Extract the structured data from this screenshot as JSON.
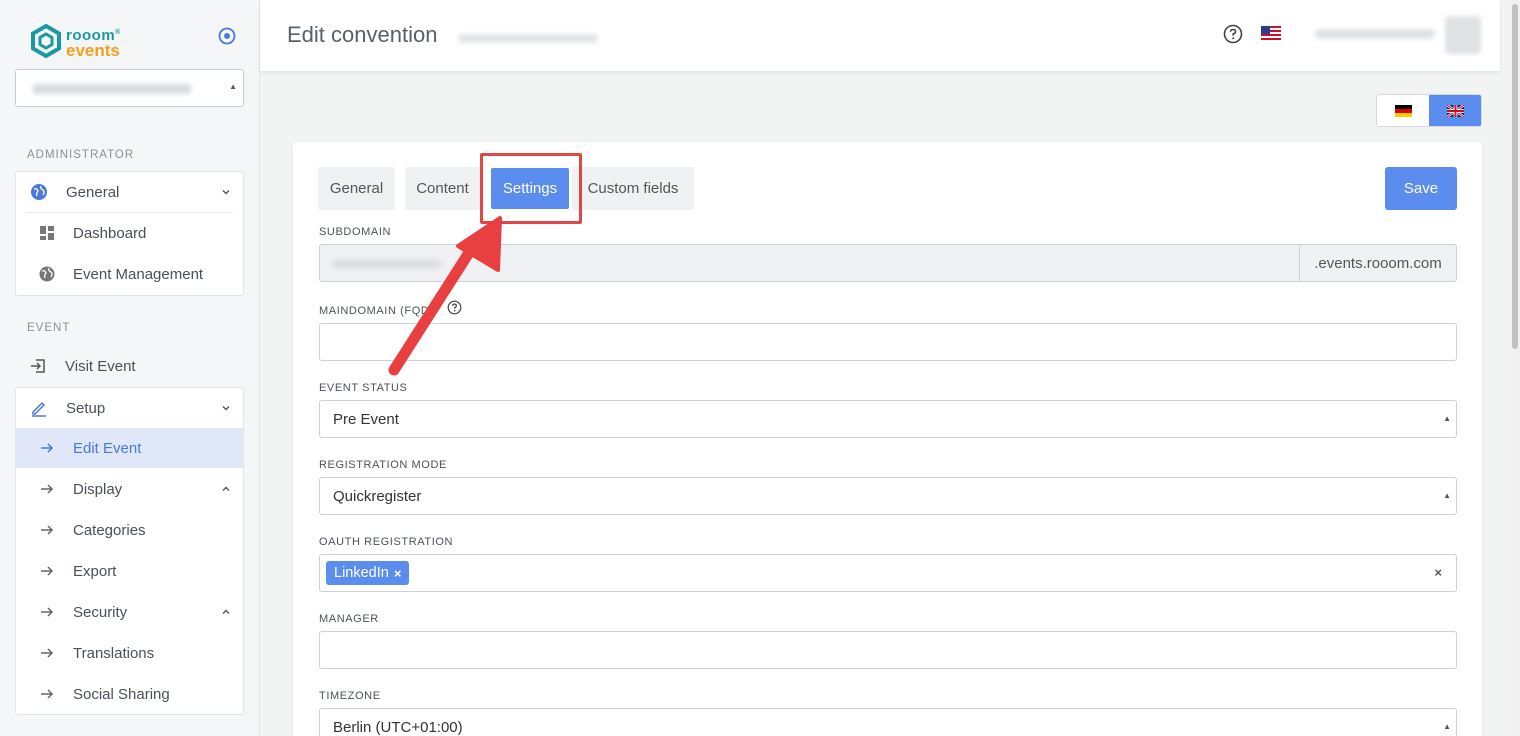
{
  "brand": {
    "line1": "rooom",
    "line2": "events",
    "reg": "®"
  },
  "sidebar": {
    "admin_label": "ADMINISTRATOR",
    "event_label": "EVENT",
    "admin_group": {
      "label": "General",
      "items": [
        "Dashboard",
        "Event Management"
      ]
    },
    "visit_event": "Visit Event",
    "setup_group": {
      "label": "Setup",
      "items": [
        "Edit Event",
        "Display",
        "Categories",
        "Export",
        "Security",
        "Translations",
        "Social Sharing"
      ]
    }
  },
  "header": {
    "title": "Edit convention"
  },
  "tabs": [
    "General",
    "Content",
    "Settings",
    "Custom fields"
  ],
  "save_label": "Save",
  "fields": {
    "subdomain_label": "SUBDOMAIN",
    "subdomain_suffix": ".events.rooom.com",
    "maindomain_label": "MAINDOMAIN (FQD",
    "maindomain_value": "",
    "event_status_label": "EVENT STATUS",
    "event_status_value": "Pre Event",
    "registration_mode_label": "REGISTRATION MODE",
    "registration_mode_value": "Quickregister",
    "oauth_label": "OAUTH REGISTRATION",
    "oauth_chip": "LinkedIn",
    "manager_label": "MANAGER",
    "manager_value": "",
    "timezone_label": "TIMEZONE",
    "timezone_value": "Berlin (UTC+01:00)"
  },
  "colors": {
    "accent": "#5b8def",
    "highlight": "#e04848",
    "brand_teal": "#1a9aa0",
    "brand_orange": "#f0a020"
  }
}
